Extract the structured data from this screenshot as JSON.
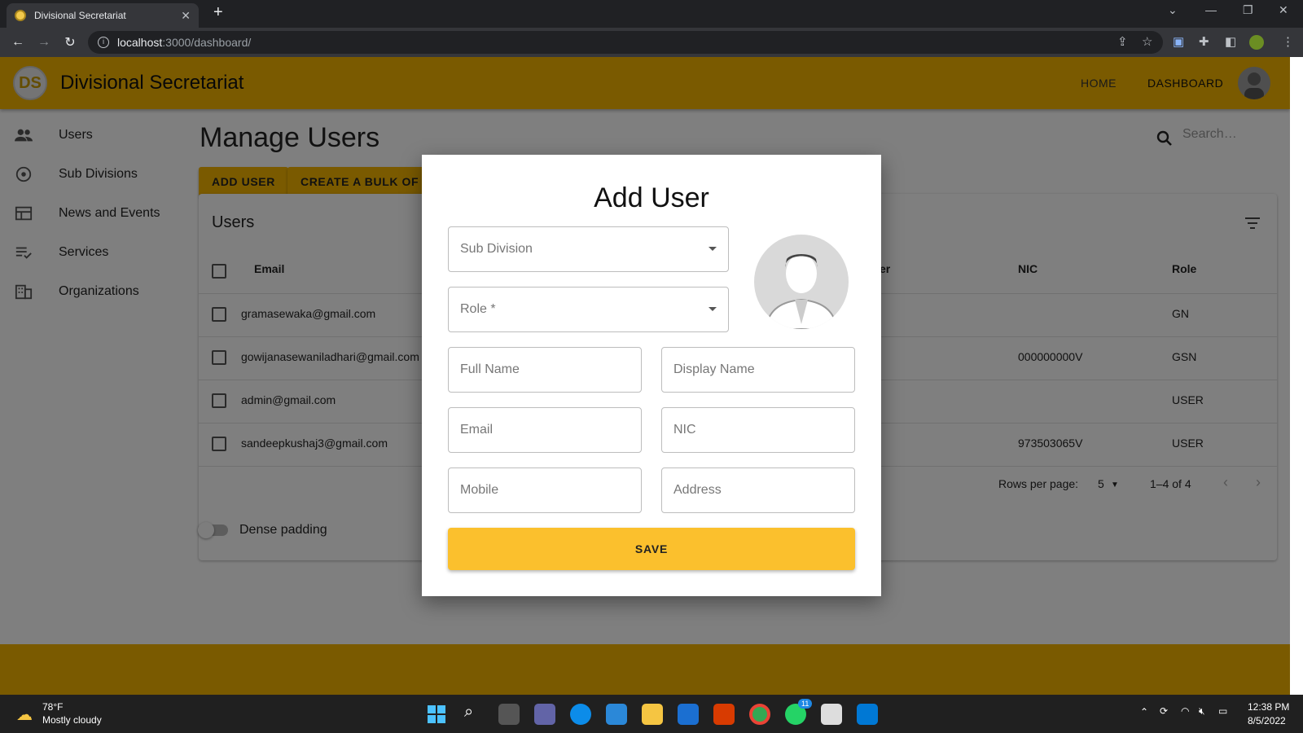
{
  "browser": {
    "tab_title": "Divisional Secretariat",
    "url_host": "localhost",
    "url_path": ":3000/dashboard/"
  },
  "app": {
    "logo_text": "DS",
    "title": "Divisional Secretariat",
    "nav": {
      "home": "HOME",
      "dashboard": "DASHBOARD"
    }
  },
  "sidebar": {
    "items": [
      {
        "label": "Users"
      },
      {
        "label": "Sub Divisions"
      },
      {
        "label": "News and Events"
      },
      {
        "label": "Services"
      },
      {
        "label": "Organizations"
      }
    ]
  },
  "page": {
    "title": "Manage Users",
    "add_user": "ADD USER",
    "bulk": "CREATE A BULK OF US",
    "search_placeholder": "Search…"
  },
  "table": {
    "title": "Users",
    "headers": {
      "email": "Email",
      "er": "er",
      "nic": "NIC",
      "role": "Role"
    },
    "rows": [
      {
        "email": "gramasewaka@gmail.com",
        "nic": "",
        "role": "GN"
      },
      {
        "email": "gowijanasewaniladhari@gmail.com",
        "nic": "000000000V",
        "role": "GSN"
      },
      {
        "email": "admin@gmail.com",
        "nic": "",
        "role": "USER"
      },
      {
        "email": "sandeepkushaj3@gmail.com",
        "nic": "973503065V",
        "role": "USER"
      }
    ],
    "rows_per_page_label": "Rows per page:",
    "rows_per_page": "5",
    "range": "1–4 of 4"
  },
  "dense_label": "Dense padding",
  "modal": {
    "title": "Add User",
    "sub_division": "Sub Division",
    "role": "Role *",
    "full_name": "Full Name",
    "display_name": "Display Name",
    "email": "Email",
    "nic": "NIC",
    "mobile": "Mobile",
    "address": "Address",
    "save": "SAVE"
  },
  "taskbar": {
    "temp": "78°F",
    "weather": "Mostly cloudy",
    "time": "12:38 PM",
    "date": "8/5/2022",
    "whatsapp_badge": "11"
  },
  "colors": {
    "primary": "#f4b400",
    "save": "#fbc02d"
  }
}
